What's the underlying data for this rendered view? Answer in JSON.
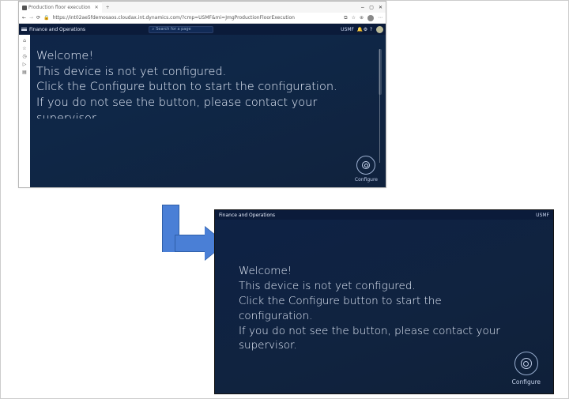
{
  "browser": {
    "tab_title": "Production floor execution",
    "url": "https://int02ae5fdemosaos.cloudax.int.dynamics.com/?cmp=USMF&mi=JmgProductionFloorExecution",
    "minimize": "−",
    "restore": "▢",
    "close": "✕",
    "back": "←",
    "forward": "→",
    "refresh": "⟳"
  },
  "app": {
    "title": "Finance and Operations",
    "search_placeholder": "Search for a page",
    "company": "USMF"
  },
  "welcome": {
    "heading": "Welcome!",
    "line1": "This device is not yet configured.",
    "line2": "Click the Configure button to start the configuration.",
    "line3": "If you do not see the button, please contact your",
    "line4_cut": "supervisor",
    "line4_full": "supervisor."
  },
  "configure": {
    "label": "Configure"
  },
  "colors": {
    "navbar": "#0b1b3a",
    "panel_grad_a": "#0f2548",
    "arrow_fill": "#4a7fd6",
    "arrow_stroke": "#2f5fa8"
  }
}
